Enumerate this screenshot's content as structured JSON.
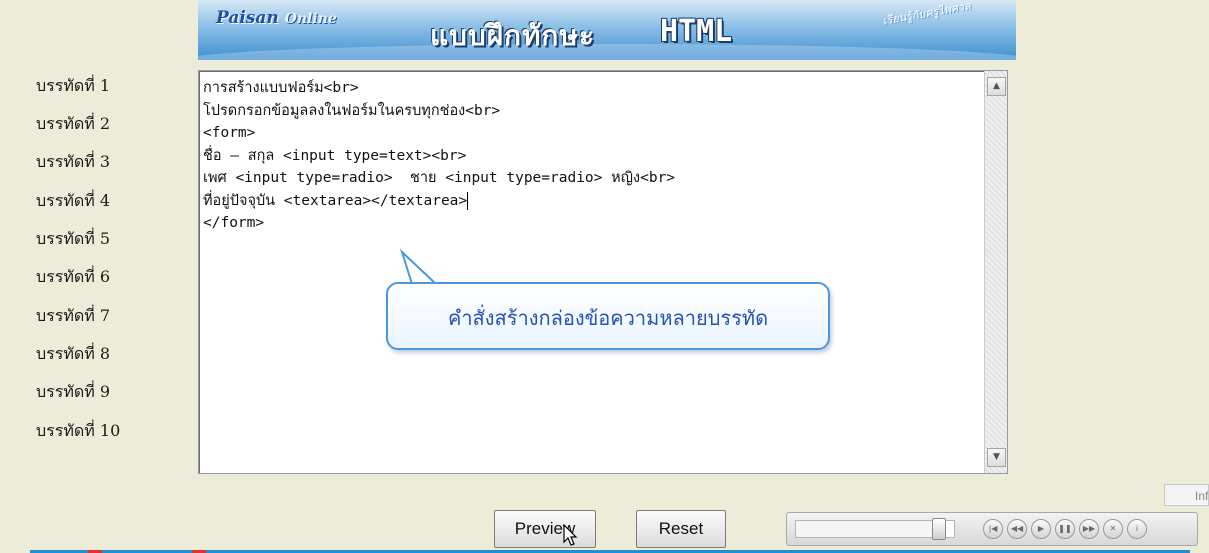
{
  "banner": {
    "brand": "Paisan",
    "brand_sub": "Online",
    "title": "แบบฝึกทักษะ",
    "html_logo": "HTML",
    "script_text": "เรียนรู้กับครูไพศาล"
  },
  "line_labels": [
    "บรรทัดที่ 1",
    "บรรทัดที่ 2",
    "บรรทัดที่ 3",
    "บรรทัดที่ 4",
    "บรรทัดที่ 5",
    "บรรทัดที่ 6",
    "บรรทัดที่ 7",
    "บรรทัดที่ 8",
    "บรรทัดที่ 9",
    "บรรทัดที่ 10"
  ],
  "editor": {
    "lines": [
      "การสร้างแบบฟอร์ม<br>",
      "โปรดกรอกข้อมูลลงในฟอร์มในครบทุกช่อง<br>",
      "<form>",
      "ชื่อ – สกุล <input type=text><br>",
      "เพศ <input type=radio>  ชาย <input type=radio> หญิง<br>",
      "ที่อยู่ปัจจุบัน <textarea></textarea>",
      "</form>"
    ],
    "caret_line": 5
  },
  "callout": {
    "text": "คำสั่งสร้างกล่องข้อความหลายบรรทัด"
  },
  "buttons": {
    "preview": "Preview",
    "reset": "Reset"
  },
  "player": {
    "seek_fraction": 0.9,
    "controls": [
      {
        "name": "skip-start-icon",
        "glyph": "|◀"
      },
      {
        "name": "rewind-icon",
        "glyph": "◀◀"
      },
      {
        "name": "play-icon",
        "glyph": "▶"
      },
      {
        "name": "pause-icon",
        "glyph": "❚❚"
      },
      {
        "name": "fast-forward-icon",
        "glyph": "▶▶"
      },
      {
        "name": "close-icon",
        "glyph": "✕"
      },
      {
        "name": "info-icon",
        "glyph": "i"
      }
    ]
  },
  "info_tab": "Inf",
  "colors": {
    "page_bg": "#ececd9",
    "accent_blue": "#1f8fd6",
    "callout_text": "#2450b8",
    "callout_border": "#4a98d8"
  }
}
